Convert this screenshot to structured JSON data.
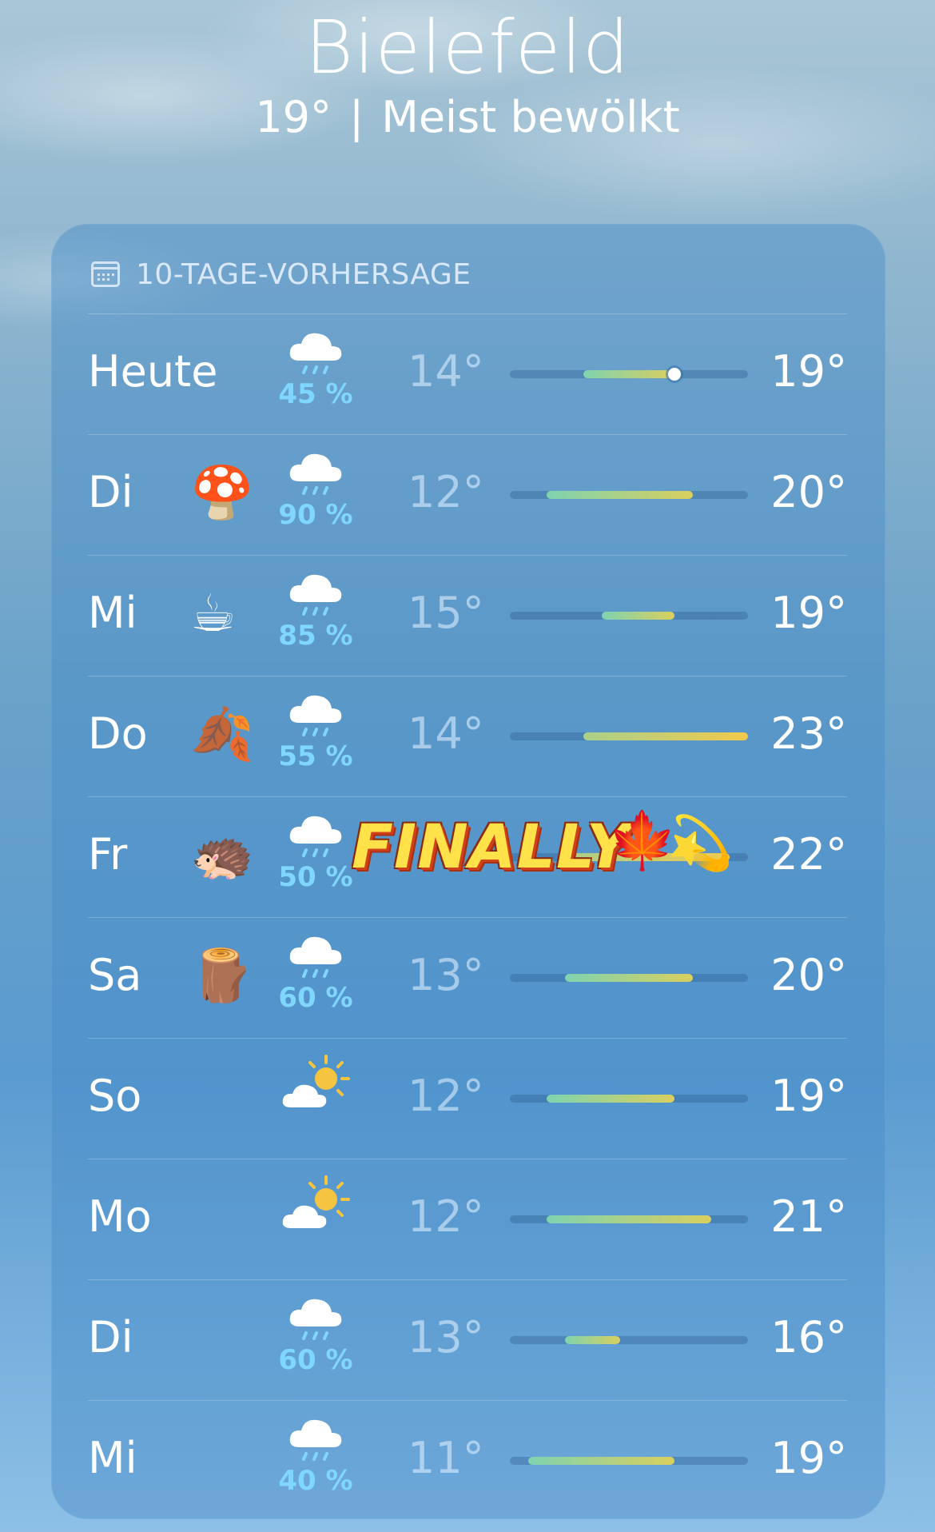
{
  "header": {
    "city": "Bielefeld",
    "current_temp": "19°",
    "separator": "|",
    "condition": "Meist bewölkt"
  },
  "forecast": {
    "title": "10-TAGE-VORHERSAGE",
    "days": [
      {
        "day": "Heute",
        "emoji": "",
        "weather": "rain-cloud",
        "pop": "45 %",
        "low": "14°",
        "high": "19°",
        "range": [
          14,
          19
        ],
        "current": 19
      },
      {
        "day": "Di",
        "emoji": "🍄",
        "weather": "rain-cloud",
        "pop": "90 %",
        "low": "12°",
        "high": "20°",
        "range": [
          12,
          20
        ]
      },
      {
        "day": "Mi",
        "emoji": "☕",
        "weather": "rain-cloud",
        "pop": "85 %",
        "low": "15°",
        "high": "19°",
        "range": [
          15,
          19
        ]
      },
      {
        "day": "Do",
        "emoji": "🍂",
        "weather": "rain-cloud",
        "pop": "55 %",
        "low": "14°",
        "high": "23°",
        "range": [
          14,
          23
        ]
      },
      {
        "day": "Fr",
        "emoji": "🦔",
        "weather": "rain-cloud",
        "pop": "50 %",
        "low": "",
        "high": "22°",
        "range": [
          13,
          22
        ]
      },
      {
        "day": "Sa",
        "emoji": "🪵",
        "weather": "rain-cloud",
        "pop": "60 %",
        "low": "13°",
        "high": "20°",
        "range": [
          13,
          20
        ]
      },
      {
        "day": "So",
        "emoji": "",
        "weather": "partly-sunny",
        "pop": "",
        "low": "12°",
        "high": "19°",
        "range": [
          12,
          19
        ]
      },
      {
        "day": "Mo",
        "emoji": "",
        "weather": "partly-sunny",
        "pop": "",
        "low": "12°",
        "high": "21°",
        "range": [
          12,
          21
        ]
      },
      {
        "day": "Di",
        "emoji": "",
        "weather": "rain-cloud",
        "pop": "60 %",
        "low": "13°",
        "high": "16°",
        "range": [
          13,
          16
        ]
      },
      {
        "day": "Mi",
        "emoji": "",
        "weather": "rain-cloud",
        "pop": "40 %",
        "low": "11°",
        "high": "19°",
        "range": [
          11,
          19
        ]
      }
    ],
    "scale": [
      10,
      23
    ]
  },
  "sticker": {
    "text": "FINALLY",
    "leaf": "🍁",
    "star": "💫"
  },
  "colors": {
    "pop": "#7fd7ff",
    "bar_cool": "#7fd3b0",
    "bar_warm": "#f5c542"
  }
}
